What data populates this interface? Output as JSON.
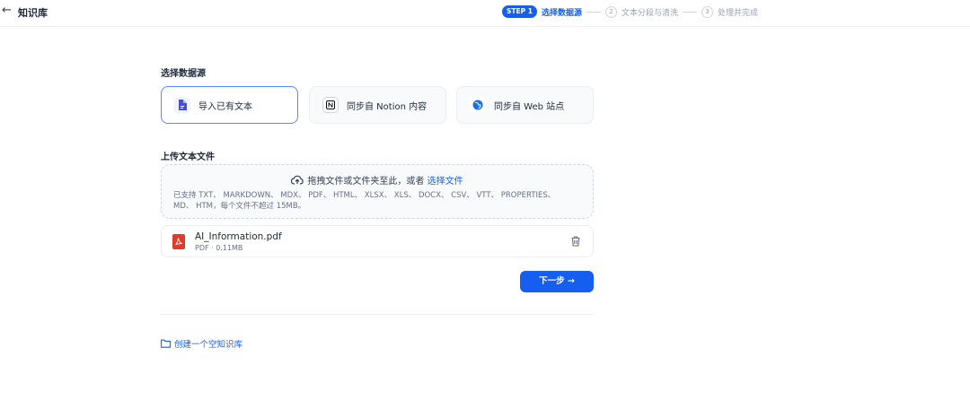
{
  "header": {
    "back_icon": "arrow-left-icon",
    "title": "知识库"
  },
  "steps": {
    "step1_badge": "STEP 1",
    "step1_label": "选择数据源",
    "step2_num": "2",
    "step2_label": "文本分段与清洗",
    "step3_num": "3",
    "step3_label": "处理并完成"
  },
  "source": {
    "title": "选择数据源",
    "options": [
      {
        "label": "导入已有文本",
        "icon": "document-icon",
        "selected": true
      },
      {
        "label": "同步自 Notion 内容",
        "icon": "notion-icon",
        "selected": false
      },
      {
        "label": "同步自 Web 站点",
        "icon": "globe-icon",
        "selected": false
      }
    ]
  },
  "upload": {
    "title": "上传文本文件",
    "drop_text": "拖拽文件或文件夹至此，或者",
    "select_link": "选择文件",
    "tip_line1": "已支持 TXT、 MARKDOWN、 MDX、 PDF、 HTML、 XLSX、 XLS、 DOCX、 CSV、 VTT、 PROPERTIES、",
    "tip_line2": "MD、 HTM，每个文件不超过 15MB。"
  },
  "file": {
    "name": "AI_Information.pdf",
    "meta": "PDF · 0.11MB"
  },
  "actions": {
    "next": "下一步 →",
    "create_empty": "创建一个空知识库"
  },
  "colors": {
    "accent": "#155eef",
    "pdf": "#e03b2b"
  }
}
